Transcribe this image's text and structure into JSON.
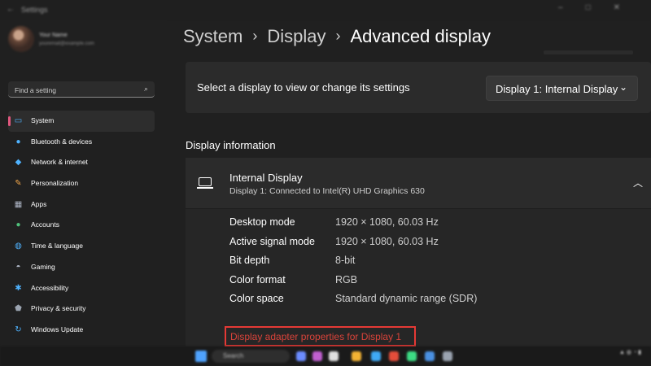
{
  "window": {
    "app_title": "Settings"
  },
  "profile": {
    "name": "Your Name",
    "email": "youremail@example.com"
  },
  "search": {
    "placeholder": "Find a setting"
  },
  "sidebar": {
    "items": [
      {
        "label": "System",
        "icon": "system-icon",
        "active": true
      },
      {
        "label": "Bluetooth & devices",
        "icon": "bluetooth-icon"
      },
      {
        "label": "Network & internet",
        "icon": "wifi-icon"
      },
      {
        "label": "Personalization",
        "icon": "brush-icon"
      },
      {
        "label": "Apps",
        "icon": "apps-icon"
      },
      {
        "label": "Accounts",
        "icon": "accounts-icon"
      },
      {
        "label": "Time & language",
        "icon": "globe-icon"
      },
      {
        "label": "Gaming",
        "icon": "gamepad-icon"
      },
      {
        "label": "Accessibility",
        "icon": "accessibility-icon"
      },
      {
        "label": "Privacy & security",
        "icon": "shield-icon"
      },
      {
        "label": "Windows Update",
        "icon": "update-icon"
      }
    ]
  },
  "breadcrumb": {
    "parts": [
      "System",
      "Display"
    ],
    "current": "Advanced display"
  },
  "display_select": {
    "label": "Select a display to view or change its settings",
    "value": "Display 1: Internal Display"
  },
  "display_info": {
    "section_title": "Display information",
    "name": "Internal Display",
    "subtitle": "Display 1: Connected to Intel(R) UHD Graphics 630",
    "properties": [
      {
        "label": "Desktop mode",
        "value": "1920 × 1080, 60.03 Hz"
      },
      {
        "label": "Active signal mode",
        "value": "1920 × 1080, 60.03 Hz"
      },
      {
        "label": "Bit depth",
        "value": "8-bit"
      },
      {
        "label": "Color format",
        "value": "RGB"
      },
      {
        "label": "Color space",
        "value": "Standard dynamic range (SDR)"
      }
    ],
    "adapter_link": "Display adapter properties for Display 1"
  },
  "taskbar": {
    "search_label": "Search"
  },
  "colors": {
    "accent": "#4fb3ff",
    "active_indicator": "#e0577e",
    "highlight_box": "#e53935"
  }
}
